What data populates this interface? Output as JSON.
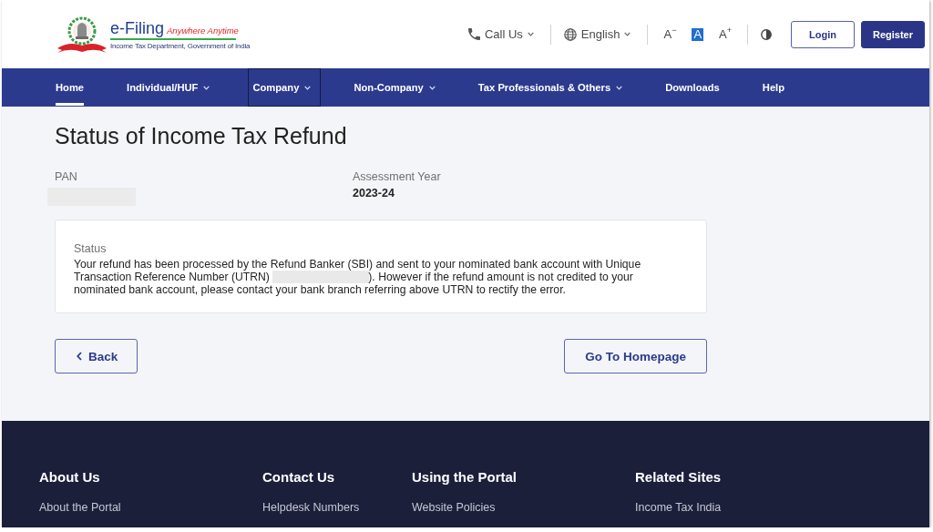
{
  "header": {
    "logo": {
      "title": "e-Filing",
      "tagline": "Anywhere Anytime",
      "subtitle": "Income Tax Department, Government of India"
    },
    "call_us": {
      "label": "Call Us"
    },
    "language": {
      "label": "English"
    },
    "font_size_buttons": [
      {
        "label": "A",
        "sign": "−",
        "selected": false
      },
      {
        "label": "A",
        "selected": true
      },
      {
        "label": "A",
        "sign": "+",
        "selected": false
      }
    ],
    "login": "Login",
    "register": "Register"
  },
  "nav": [
    {
      "label": "Home",
      "selected": true,
      "focused": false,
      "has_menu": false
    },
    {
      "label": "Individual/HUF",
      "selected": false,
      "focused": false,
      "has_menu": true
    },
    {
      "label": "Company",
      "selected": false,
      "focused": true,
      "has_menu": true
    },
    {
      "label": "Non-Company",
      "selected": false,
      "focused": false,
      "has_menu": true
    },
    {
      "label": "Tax Professionals & Others",
      "selected": false,
      "focused": false,
      "has_menu": true
    },
    {
      "label": "Downloads",
      "selected": false,
      "focused": false,
      "has_menu": false
    },
    {
      "label": "Help",
      "selected": false,
      "focused": false,
      "has_menu": false
    }
  ],
  "page": {
    "title": "Status of Income Tax Refund",
    "fields": [
      {
        "label": "PAN",
        "redacted": true
      },
      {
        "label": "Assessment Year",
        "value": "2023-24",
        "redacted": false
      }
    ],
    "status": {
      "label": "Status",
      "message": [
        {
          "kind": "text",
          "text": "Your refund has been processed by the Refund Banker (SBI) and sent to your nominated bank account with Unique Transaction Reference Number (UTRN) "
        },
        {
          "kind": "redacted"
        },
        {
          "kind": "text",
          "text": "). However if the refund amount is not credited to your nominated bank account, please contact your bank branch referring above UTRN to rectify the error."
        }
      ]
    },
    "buttons": [
      {
        "label": "Back",
        "kind": "back"
      },
      {
        "label": "Go To Homepage",
        "kind": "plain"
      }
    ]
  },
  "footer": {
    "columns": [
      {
        "heading": "About Us",
        "links": [
          "About the Portal"
        ]
      },
      {
        "heading": "Contact Us",
        "links": [
          "Helpdesk Numbers"
        ]
      },
      {
        "heading": "Using the Portal",
        "links": [
          "Website Policies"
        ]
      },
      {
        "heading": "Related Sites",
        "links": [
          "Income Tax India"
        ]
      }
    ]
  }
}
